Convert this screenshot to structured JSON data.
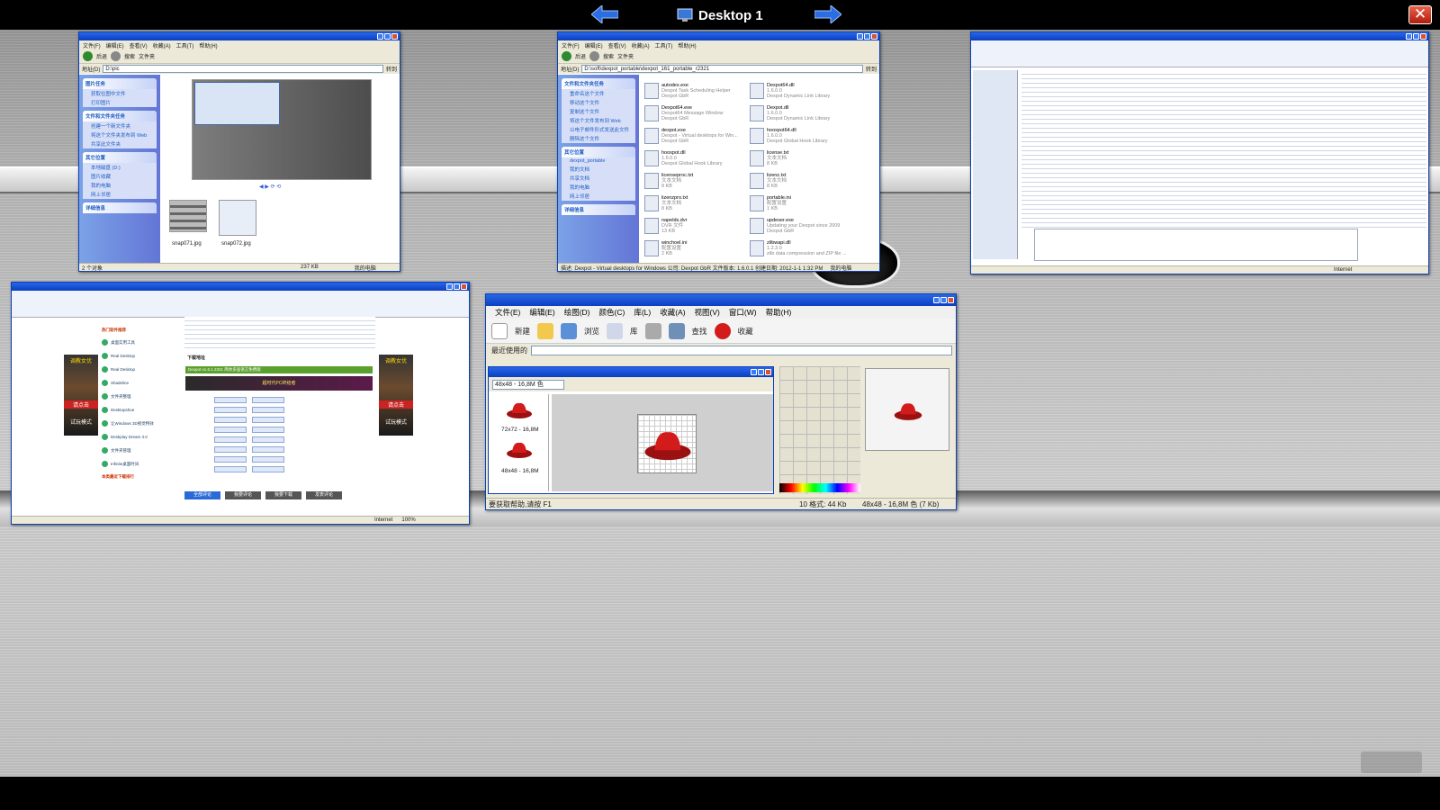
{
  "desktop": {
    "title": "Desktop 1",
    "prev_label": "previous-desktop",
    "next_label": "next-desktop",
    "close_label": "close"
  },
  "windows": {
    "pics": {
      "menu": [
        "文件(F)",
        "编辑(E)",
        "查看(V)",
        "收藏(A)",
        "工具(T)",
        "帮助(H)"
      ],
      "toolbar": [
        "后退",
        "搜索",
        "文件夹"
      ],
      "address_label": "地址(D)",
      "address": "D:\\pic",
      "go": "转到",
      "task1_title": "图片任务",
      "task1_items": [
        "获取位图中文件",
        "打印图片"
      ],
      "task2_title": "文件和文件夹任务",
      "task2_items": [
        "创建一个新文件夹",
        "将这个文件夹发布到 Web",
        "共享此文件夹"
      ],
      "task3_title": "其它位置",
      "task3_items": [
        "本地磁盘 (D:)",
        "图片收藏",
        "我的电脑",
        "网上邻居"
      ],
      "task4_title": "详细信息",
      "files": [
        "snap071.jpg",
        "snap072.jpg"
      ],
      "status": [
        "2 个对象",
        "237 KB",
        "我的电脑"
      ]
    },
    "dexpot": {
      "menu": [
        "文件(F)",
        "编辑(E)",
        "查看(V)",
        "收藏(A)",
        "工具(T)",
        "帮助(H)"
      ],
      "toolbar": [
        "后退",
        "搜索",
        "文件夹"
      ],
      "address_label": "地址(D)",
      "address": "D:\\soft\\dexpot_portable\\dexpot_161_portable_r2321",
      "go": "转到",
      "task1_title": "文件和文件夹任务",
      "task1_items": [
        "重命名这个文件",
        "移动这个文件",
        "复制这个文件",
        "将这个文件发布到 Web",
        "以电子邮件形式发送此文件",
        "删除这个文件"
      ],
      "task2_title": "其它位置",
      "task2_items": [
        "dexpot_portable",
        "我的文档",
        "共享文档",
        "我的电脑",
        "网上邻居"
      ],
      "task3_title": "详细信息",
      "files_left": [
        {
          "name": "autodex.exe",
          "desc": "Dexpot Task Scheduling Helper",
          "sub": "Dexpot GbR"
        },
        {
          "name": "Dexpot64.exe",
          "desc": "Dexpot64 Message Window",
          "sub": "Dexpot GbR"
        },
        {
          "name": "dexpot.exe",
          "desc": "Dexpot - Virtual desktops for Win...",
          "sub": "Dexpot GbR"
        },
        {
          "name": "hooxpot.dll",
          "desc": "1.6.0.0",
          "sub": "Dexpot Global Hook Library"
        },
        {
          "name": "licenseproc.txt",
          "desc": "文本文档",
          "sub": "8 KB"
        },
        {
          "name": "lizenzpro.txt",
          "desc": "文本文档",
          "sub": "8 KB"
        },
        {
          "name": "napelds.dvr",
          "desc": "DVR 文件",
          "sub": "13 KB"
        },
        {
          "name": "winchoel.ini",
          "desc": "配置设置",
          "sub": "2 KB"
        }
      ],
      "files_right": [
        {
          "name": "Dexpot64.dll",
          "desc": "1.6.0.0",
          "sub": "Dexpot Dynamic Link Library"
        },
        {
          "name": "Dexpot.dll",
          "desc": "1.6.0.0",
          "sub": "Dexpot Dynamic Link Library"
        },
        {
          "name": "hooxpot64.dll",
          "desc": "1.6.0.0",
          "sub": "Dexpot Global Hook Library"
        },
        {
          "name": "license.txt",
          "desc": "文本文档",
          "sub": "8 KB"
        },
        {
          "name": "lizenz.txt",
          "desc": "文本文档",
          "sub": "8 KB"
        },
        {
          "name": "portable.ini",
          "desc": "配置设置",
          "sub": "1 KB"
        },
        {
          "name": "updeser.exe",
          "desc": "Updating your Dexpot since 2009",
          "sub": "Dexpot GbR"
        },
        {
          "name": "zlibwapi.dll",
          "desc": "1.2.3.0",
          "sub": "zlib data compression and ZIP file ..."
        }
      ],
      "status": "描述: Dexpot - Virtual desktops for Windows 公司: Dexpot GbR 文件版本: 1.6.0.1 创建日期: 2012-1-1 1:32 PM",
      "status_right": "我的电脑"
    },
    "blogform": {
      "status": "Internet"
    },
    "webpage": {
      "ad_text": "调教女优",
      "ad_sub": "试玩模式",
      "ad_badge": "请点击",
      "section_title": "下载地址",
      "download_title": "Dexpot v1.6.1.2321 简体多国语言免费版",
      "banner": "超时代PC终结者",
      "sidebar_title": "热门软件推荐",
      "sidebar_items": [
        "桌面实用工具",
        "Real Desktop",
        "Real Desktop",
        "Shadeline",
        "文件夹整理",
        "Desktopshoe",
        "让Windows 3D视觉特效",
        "Deskplay Dream 3.0",
        "文件夹管理",
        "Infinite桌面时间"
      ],
      "rank_title": "本类最近下载排行",
      "buttons": [
        "全部评论",
        "我要评论",
        "我要下载",
        "发表评论"
      ],
      "status": [
        "Internet",
        "100%"
      ]
    },
    "iconeditor": {
      "menu": [
        "文件(E)",
        "编辑(E)",
        "绘图(D)",
        "颜色(C)",
        "库(L)",
        "收藏(A)",
        "视图(V)",
        "窗口(W)",
        "帮助(H)"
      ],
      "toolbar": [
        "新建",
        "浏览",
        "库",
        "查找",
        "收藏"
      ],
      "recent_label": "最近使用的",
      "size_select": "48x48 - 16,8M 色",
      "icon_labels": [
        "72x72 - 16,8M",
        "48x48 - 16,8M"
      ],
      "status_left": "要获取帮助,请按 F1",
      "status_mid": "10 格式: 44 Kb",
      "status_right": "48x48 - 16,8M 色 (7 Kb)"
    }
  },
  "colors": {
    "xp_title_blue": "#0a3fc0",
    "close_red": "#c0281a",
    "arrow_blue": "#2c6de0",
    "hat_red": "#d41b1b"
  }
}
